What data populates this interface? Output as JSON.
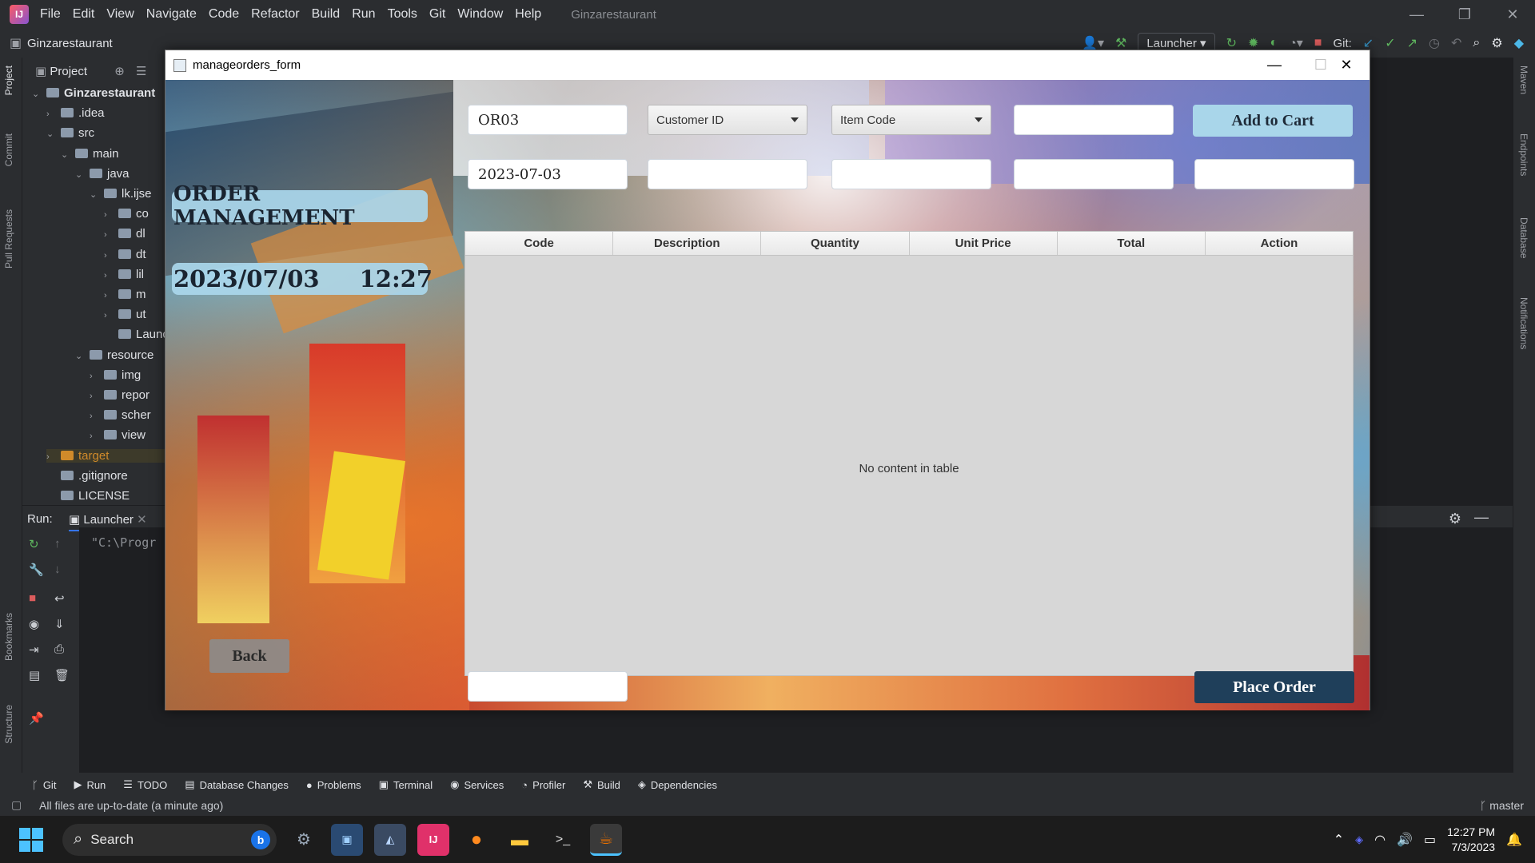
{
  "ide": {
    "menu": [
      "File",
      "Edit",
      "View",
      "Navigate",
      "Code",
      "Refactor",
      "Build",
      "Run",
      "Tools",
      "Git",
      "Window",
      "Help"
    ],
    "project_title": "Ginzarestaurant",
    "nav_project": "Ginzarestaurant",
    "run_config": "Launcher",
    "git_label": "Git:",
    "project_panel_title": "Project",
    "tree": [
      {
        "label": "Ginzarestaurant",
        "indent": 0,
        "bold": true,
        "arrow": "v"
      },
      {
        "label": ".idea",
        "indent": 1,
        "arrow": ">"
      },
      {
        "label": "src",
        "indent": 1,
        "arrow": "v"
      },
      {
        "label": "main",
        "indent": 2,
        "arrow": "v"
      },
      {
        "label": "java",
        "indent": 3,
        "arrow": "v"
      },
      {
        "label": "lk.ijse",
        "indent": 4,
        "arrow": "v"
      },
      {
        "label": "co",
        "indent": 5,
        "arrow": ">"
      },
      {
        "label": "dl",
        "indent": 5,
        "arrow": ">"
      },
      {
        "label": "dt",
        "indent": 5,
        "arrow": ">"
      },
      {
        "label": "lil",
        "indent": 5,
        "arrow": ">"
      },
      {
        "label": "m",
        "indent": 5,
        "arrow": ">"
      },
      {
        "label": "ut",
        "indent": 5,
        "arrow": ">"
      },
      {
        "label": "Launc",
        "indent": 5,
        "arrow": ""
      },
      {
        "label": "resource",
        "indent": 3,
        "arrow": "v"
      },
      {
        "label": "img",
        "indent": 4,
        "arrow": ">"
      },
      {
        "label": "repor",
        "indent": 4,
        "arrow": ">"
      },
      {
        "label": "scher",
        "indent": 4,
        "arrow": ">"
      },
      {
        "label": "view",
        "indent": 4,
        "arrow": ">"
      },
      {
        "label": "target",
        "indent": 1,
        "arrow": ">",
        "orange": true
      },
      {
        "label": ".gitignore",
        "indent": 1,
        "arrow": ""
      },
      {
        "label": "LICENSE",
        "indent": 1,
        "arrow": ""
      }
    ],
    "left_strip": [
      "Project",
      "Commit",
      "Pull Requests",
      "Bookmarks",
      "Structure"
    ],
    "right_strip": [
      "Maven",
      "Endpoints",
      "Database",
      "Notifications"
    ],
    "run_label": "Run:",
    "run_tab": "Launcher",
    "console_text": "\"C:\\Progr",
    "bottom_tabs": [
      "Git",
      "Run",
      "TODO",
      "Database Changes",
      "Problems",
      "Terminal",
      "Services",
      "Profiler",
      "Build",
      "Dependencies"
    ],
    "status_text": "All files are up-to-date (a minute ago)",
    "branch": "master"
  },
  "window": {
    "title": "manageorders_form",
    "heading": "ORDER MANAGEMENT",
    "date": "2023/07/03",
    "time": "12:27",
    "order_id": "OR03",
    "customer_id_placeholder": "Customer ID",
    "item_code_placeholder": "Item Code",
    "order_date": "2023-07-03",
    "add_to_cart": "Add to Cart",
    "back": "Back",
    "place_order": "Place Order",
    "columns": [
      "Code",
      "Description",
      "Quantity",
      "Unit Price",
      "Total",
      "Action"
    ],
    "empty_text": "No content in table"
  },
  "taskbar": {
    "search": "Search",
    "time": "12:27 PM",
    "date": "7/3/2023"
  },
  "colors": {
    "ide_bg": "#2b2d30",
    "heading_bg": "#aad7eb",
    "add_btn_bg": "#a9d6ea",
    "place_btn_bg": "#1f3f5a",
    "back_btn_bg": "#8c8c8c"
  }
}
